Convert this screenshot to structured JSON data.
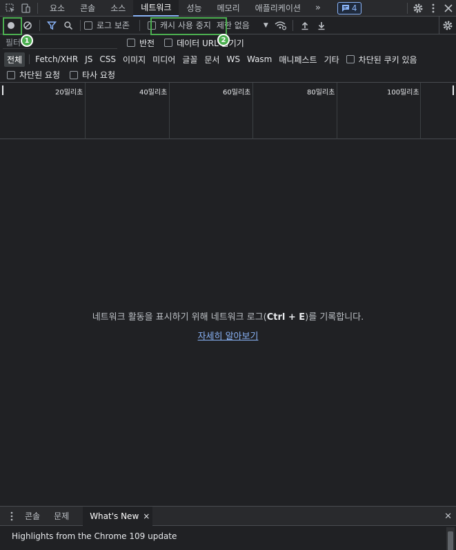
{
  "tabbar": {
    "tabs": [
      "요소",
      "콘솔",
      "소스",
      "네트워크",
      "성능",
      "메모리",
      "애플리케이션"
    ],
    "active_tab": "네트워크",
    "more": "»",
    "issues_count": "4"
  },
  "toolbar": {
    "preserve_log_label": "로그 보존",
    "disable_cache_label": "캐시 사용 중지",
    "throttle_value": "제한 없음",
    "throttle_caret": "▼"
  },
  "callouts": {
    "one": "1",
    "two": "2"
  },
  "filter": {
    "placeholder": "필터",
    "invert_label": "반전",
    "hide_data_urls_label": "데이터 URL 숨기기"
  },
  "types": [
    "전체",
    "Fetch/XHR",
    "JS",
    "CSS",
    "이미지",
    "미디어",
    "글꼴",
    "문서",
    "WS",
    "Wasm",
    "매니페스트",
    "기타"
  ],
  "blocked_cookies_label": "차단된 쿠키 있음",
  "blocked_requests_label": "차단된 요청",
  "third_party_label": "타사 요청",
  "timeline": {
    "labels": [
      "20밀리초",
      "40밀리초",
      "60밀리초",
      "80밀리초",
      "100밀리초"
    ]
  },
  "empty": {
    "msg_before": "네트워크 활동을 표시하기 위해 네트워크 로그(",
    "shortcut": "Ctrl + E",
    "msg_after": ")를 기록합니다.",
    "learn_more": "자세히 알아보기"
  },
  "drawer": {
    "tabs": [
      "콘솔",
      "문제"
    ],
    "active_tab": "What's New",
    "close_tab": "×",
    "close_drawer": "✕",
    "body": "Highlights from the Chrome 109 update"
  },
  "colors": {
    "accent": "#8ab4f8",
    "highlight": "#4caf50",
    "background": "#202124"
  }
}
